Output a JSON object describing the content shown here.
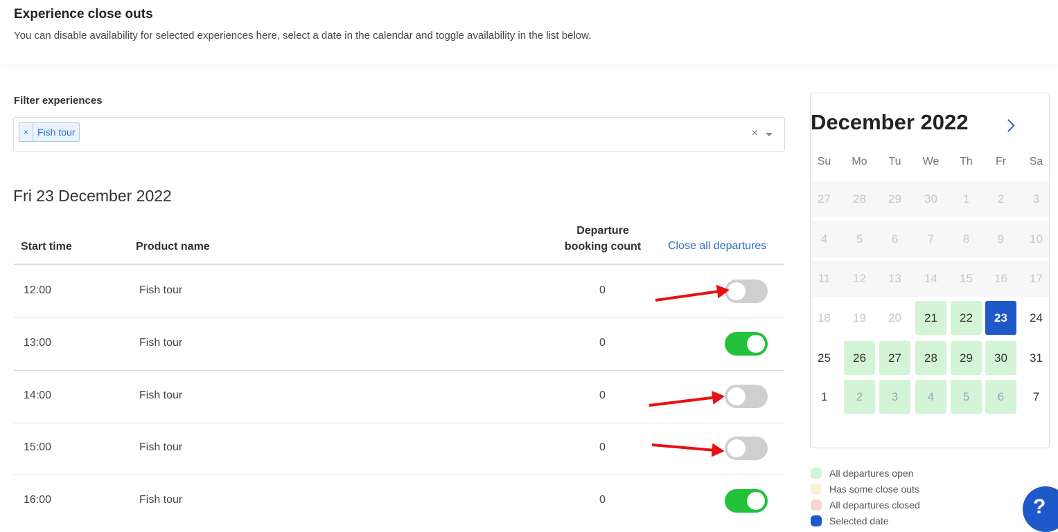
{
  "header": {
    "title": "Experience close outs",
    "description": "You can disable availability for selected experiences here, select a date in the calendar and toggle availability in the list below."
  },
  "filter": {
    "label": "Filter experiences",
    "tag": "Fish tour",
    "tag_remove": "×",
    "clear": "×"
  },
  "selected_date_heading": "Fri 23 December 2022",
  "table": {
    "columns": {
      "start_time": "Start time",
      "product_name": "Product name",
      "departure_line1": "Departure",
      "departure_line2": "booking count",
      "close_all": "Close all departures"
    },
    "rows": [
      {
        "time": "12:00",
        "product": "Fish tour",
        "count": "0",
        "enabled": false
      },
      {
        "time": "13:00",
        "product": "Fish tour",
        "count": "0",
        "enabled": true
      },
      {
        "time": "14:00",
        "product": "Fish tour",
        "count": "0",
        "enabled": false
      },
      {
        "time": "15:00",
        "product": "Fish tour",
        "count": "0",
        "enabled": false
      },
      {
        "time": "16:00",
        "product": "Fish tour",
        "count": "0",
        "enabled": true
      }
    ]
  },
  "calendar": {
    "title": "December 2022",
    "weekdays": [
      "Su",
      "Mo",
      "Tu",
      "We",
      "Th",
      "Fr",
      "Sa"
    ],
    "weeks": [
      [
        {
          "d": "27",
          "s": "muted"
        },
        {
          "d": "28",
          "s": "muted"
        },
        {
          "d": "29",
          "s": "muted"
        },
        {
          "d": "30",
          "s": "muted"
        },
        {
          "d": "1",
          "s": "muted"
        },
        {
          "d": "2",
          "s": "muted"
        },
        {
          "d": "3",
          "s": "muted"
        }
      ],
      [
        {
          "d": "4",
          "s": "muted"
        },
        {
          "d": "5",
          "s": "muted"
        },
        {
          "d": "6",
          "s": "muted"
        },
        {
          "d": "7",
          "s": "muted"
        },
        {
          "d": "8",
          "s": "muted"
        },
        {
          "d": "9",
          "s": "muted"
        },
        {
          "d": "10",
          "s": "muted"
        }
      ],
      [
        {
          "d": "11",
          "s": "muted"
        },
        {
          "d": "12",
          "s": "muted"
        },
        {
          "d": "13",
          "s": "muted"
        },
        {
          "d": "14",
          "s": "muted"
        },
        {
          "d": "15",
          "s": "muted"
        },
        {
          "d": "16",
          "s": "muted"
        },
        {
          "d": "17",
          "s": "muted"
        }
      ],
      [
        {
          "d": "18",
          "s": "muted"
        },
        {
          "d": "19",
          "s": "muted"
        },
        {
          "d": "20",
          "s": "muted"
        },
        {
          "d": "21",
          "s": "open"
        },
        {
          "d": "22",
          "s": "open"
        },
        {
          "d": "23",
          "s": "selected"
        },
        {
          "d": "24",
          "s": "normal"
        }
      ],
      [
        {
          "d": "25",
          "s": "normal"
        },
        {
          "d": "26",
          "s": "open"
        },
        {
          "d": "27",
          "s": "open"
        },
        {
          "d": "28",
          "s": "open"
        },
        {
          "d": "29",
          "s": "open"
        },
        {
          "d": "30",
          "s": "open"
        },
        {
          "d": "31",
          "s": "normal"
        }
      ],
      [
        {
          "d": "1",
          "s": "normal"
        },
        {
          "d": "2",
          "s": "open-muted"
        },
        {
          "d": "3",
          "s": "open-muted"
        },
        {
          "d": "4",
          "s": "open-muted"
        },
        {
          "d": "5",
          "s": "open-muted"
        },
        {
          "d": "6",
          "s": "open-muted"
        },
        {
          "d": "7",
          "s": "normal"
        }
      ]
    ]
  },
  "legend": [
    {
      "label": "All departures open",
      "color": "#d3f4d6"
    },
    {
      "label": "Has some close outs",
      "color": "#fbefd4"
    },
    {
      "label": "All departures closed",
      "color": "#f8d3d3"
    },
    {
      "label": "Selected date",
      "color": "#1f58c9"
    }
  ],
  "help_button": "?",
  "colors": {
    "accent": "#1f58c9",
    "toggle_on": "#22c23a",
    "toggle_off": "#cfcfcf",
    "link": "#2a6ebd",
    "annotation_arrow": "#e81010"
  }
}
